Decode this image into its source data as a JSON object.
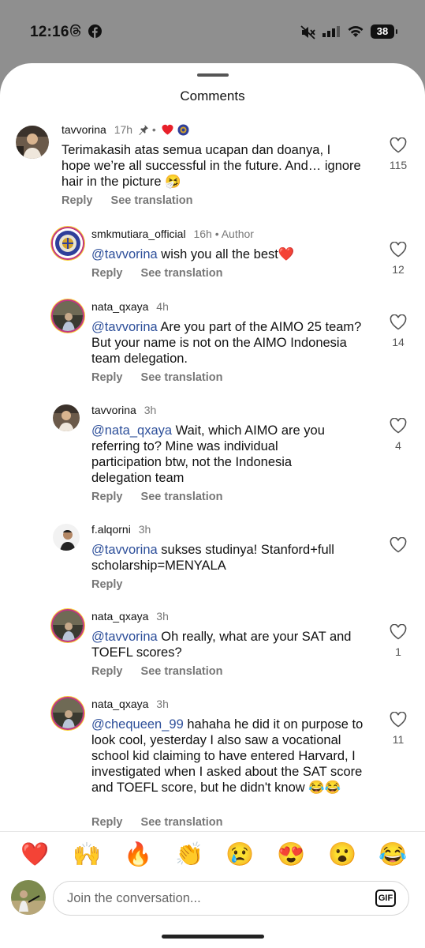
{
  "status_bar": {
    "time": "12:16",
    "battery": "38",
    "left_icons": [
      "threads-icon",
      "facebook-icon"
    ],
    "right_icons": [
      "mute-icon",
      "signal-icon",
      "wifi-icon",
      "battery-icon"
    ]
  },
  "sheet": {
    "title": "Comments"
  },
  "labels": {
    "reply": "Reply",
    "see_translation": "See translation"
  },
  "comments": [
    {
      "username": "tavvorina",
      "time": "17h",
      "badge": "",
      "mention": "",
      "text": "Terimakasih atas semua ucapan dan doanya, I hope we’re all successful in the future. And… ignore hair in the picture 🤧",
      "likes": "115",
      "pinned": true,
      "liked_by_author": true
    },
    {
      "username": "smkmutiara_official",
      "time": "16h",
      "badge": "• Author",
      "mention": "@tavvorina",
      "text": " wish you all the best❤️",
      "likes": "12"
    },
    {
      "username": "nata_qxaya",
      "time": "4h",
      "badge": "",
      "mention": "@tavvorina",
      "text": " Are you part of the AIMO 25 team? But your name is not on the AIMO Indonesia team delegation.",
      "likes": "14"
    },
    {
      "username": "tavvorina",
      "time": "3h",
      "badge": "",
      "mention": "@nata_qxaya",
      "text": " Wait, which AIMO are you referring to? Mine was individual participation btw, not the Indonesia delegation team",
      "likes": "4"
    },
    {
      "username": "f.alqorni",
      "time": "3h",
      "badge": "",
      "mention": "@tavvorina",
      "text": " sukses studinya! Stanford+full scholarship=MENYALA",
      "likes": ""
    },
    {
      "username": "nata_qxaya",
      "time": "3h",
      "badge": "",
      "mention": "@tavvorina",
      "text": " Oh really, what are your SAT and TOEFL scores?",
      "likes": "1"
    },
    {
      "username": "nata_qxaya",
      "time": "3h",
      "badge": "",
      "mention": "@chequeen_99",
      "text": " hahaha he did it on purpose to look cool, yesterday I also saw a vocational school kid claiming to have entered Harvard, I investigated when I asked about the SAT score and TOEFL score, but he didn't know 😂😂",
      "likes": "11"
    }
  ],
  "emoji_bar": [
    "❤️",
    "🙌",
    "🔥",
    "👏",
    "😢",
    "😍",
    "😮",
    "😂"
  ],
  "composer": {
    "placeholder": "Join the conversation...",
    "gif_label": "GIF"
  },
  "colors": {
    "mention": "#2d4f9a",
    "heart": "#e8202a",
    "sheet_bg": "#ffffff",
    "backdrop": "#8f8f8f"
  }
}
